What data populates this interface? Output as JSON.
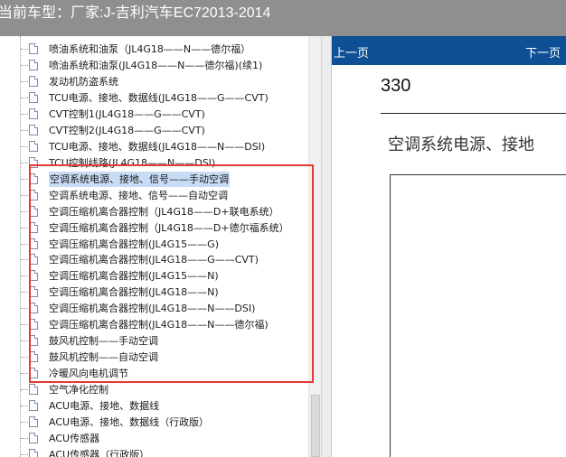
{
  "window": {
    "title": "当前车型：厂家:J-吉利汽车EC72013-2014"
  },
  "tree": {
    "items": [
      {
        "label": "喷油系统和油泵（JL4G18——N——德尔福）",
        "selected": false
      },
      {
        "label": "喷油系统和油泵(JL4G18——N——德尔福)(续1)",
        "selected": false
      },
      {
        "label": "发动机防盗系统",
        "selected": false
      },
      {
        "label": "TCU电源、接地、数据线(JL4G18——G——CVT)",
        "selected": false
      },
      {
        "label": "CVT控制1(JL4G18——G——CVT)",
        "selected": false
      },
      {
        "label": "CVT控制2(JL4G18——G——CVT)",
        "selected": false
      },
      {
        "label": "TCU电源、接地、数据线(JL4G18——N——DSI)",
        "selected": false
      },
      {
        "label": "TCU控制线路(JL4G18——N——DSI)",
        "selected": false
      },
      {
        "label": "空调系统电源、接地、信号——手动空调",
        "selected": true
      },
      {
        "label": "空调系统电源、接地、信号——自动空调",
        "selected": false
      },
      {
        "label": "空调压缩机离合器控制（JL4G18——D+联电系统）",
        "selected": false
      },
      {
        "label": "空调压缩机离合器控制（JL4G18——D+德尔福系统）",
        "selected": false
      },
      {
        "label": "空调压缩机离合器控制(JL4G15——G)",
        "selected": false
      },
      {
        "label": "空调压缩机离合器控制(JL4G18——G——CVT)",
        "selected": false
      },
      {
        "label": "空调压缩机离合器控制(JL4G15——N)",
        "selected": false
      },
      {
        "label": "空调压缩机离合器控制(JL4G18——N)",
        "selected": false
      },
      {
        "label": "空调压缩机离合器控制(JL4G18——N——DSI)",
        "selected": false
      },
      {
        "label": "空调压缩机离合器控制(JL4G18——N——德尔福)",
        "selected": false
      },
      {
        "label": "鼓风机控制——手动空调",
        "selected": false
      },
      {
        "label": "鼓风机控制——自动空调",
        "selected": false
      },
      {
        "label": "冷暖风向电机调节",
        "selected": false
      },
      {
        "label": "空气净化控制",
        "selected": false
      },
      {
        "label": "ACU电源、接地、数据线",
        "selected": false
      },
      {
        "label": "ACU电源、接地、数据线（行政版）",
        "selected": false
      },
      {
        "label": "ACU传感器",
        "selected": false
      },
      {
        "label": "ACU传感器（行政版）",
        "selected": false
      }
    ]
  },
  "viewer": {
    "prev_label": "上一页",
    "next_label": "下一页",
    "page_number": "330",
    "heading": "空调系统电源、接地"
  },
  "colors": {
    "titlebar": "#8f8f8f",
    "navbar": "#0e4f95",
    "highlight_border": "#e53935",
    "selection": "#c9dcf5"
  }
}
